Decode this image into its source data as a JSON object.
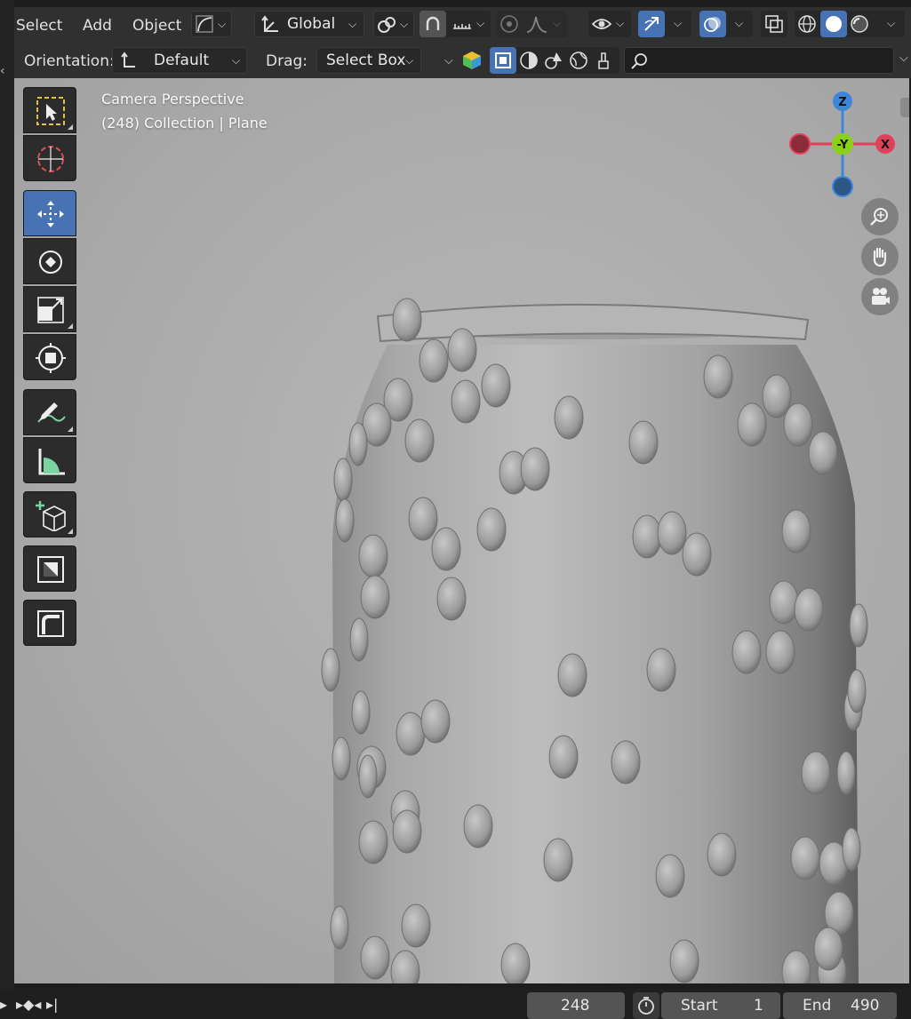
{
  "menu": {
    "select": "Select",
    "add": "Add",
    "object": "Object"
  },
  "transform": {
    "orientation_value": "Global"
  },
  "toolbar2": {
    "orientation_label": "Orientation:",
    "orientation_value": "Default",
    "drag_label": "Drag:",
    "drag_value": "Select Box",
    "search_placeholder": ""
  },
  "viewport": {
    "camera_label": "Camera Perspective",
    "collection_label": "(248) Collection | Plane"
  },
  "gizmo": {
    "z": "Z",
    "y": "-Y",
    "x": "X"
  },
  "tools": [
    "select-box-icon",
    "cursor-icon",
    "move-icon",
    "rotate-icon",
    "scale-icon",
    "transform-icon",
    "annotate-icon",
    "measure-icon",
    "add-cube-icon",
    "inset-icon",
    "bevel-icon"
  ],
  "timeline": {
    "current_frame": "248",
    "start_label": "Start",
    "start_value": "1",
    "end_label": "End",
    "end_value": "490"
  },
  "colors": {
    "active_blue": "#4772b3",
    "axis_x": "#e0415a",
    "axis_y": "#8ad016",
    "axis_z": "#3d87db"
  }
}
